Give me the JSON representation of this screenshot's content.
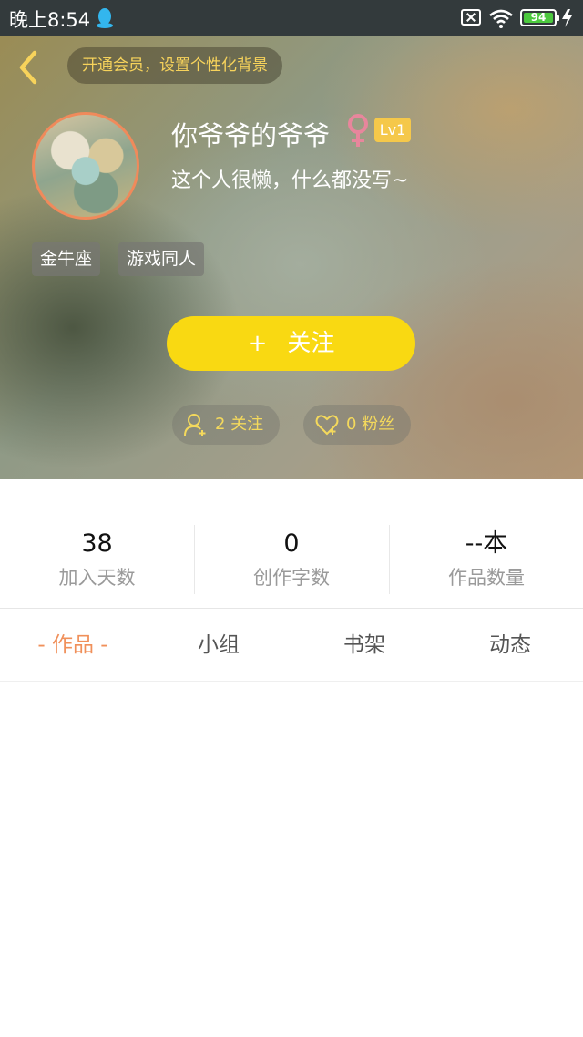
{
  "status_bar": {
    "time": "晚上8:54",
    "battery": "94"
  },
  "header": {
    "vip_banner": "开通会员，设置个性化背景",
    "nickname": "你爷爷的爷爷",
    "level": "Lv1",
    "signature": "这个人很懒，什么都没写~",
    "tags": [
      "金牛座",
      "游戏同人"
    ],
    "follow_button": {
      "plus": "+",
      "label": "关注"
    },
    "following": "2 关注",
    "fans": "0 粉丝"
  },
  "stats": [
    {
      "value": "38",
      "label": "加入天数"
    },
    {
      "value": "0",
      "label": "创作字数"
    },
    {
      "value": "--本",
      "label": "作品数量"
    }
  ],
  "tabs": [
    {
      "label": "- 作品 -"
    },
    {
      "label": "小组"
    },
    {
      "label": "书架"
    },
    {
      "label": "动态"
    }
  ],
  "colors": {
    "accent_yellow": "#f9d912",
    "active_tab": "#f0905a",
    "battery_green": "#4cc93f",
    "gender_pink": "#e8869c"
  }
}
